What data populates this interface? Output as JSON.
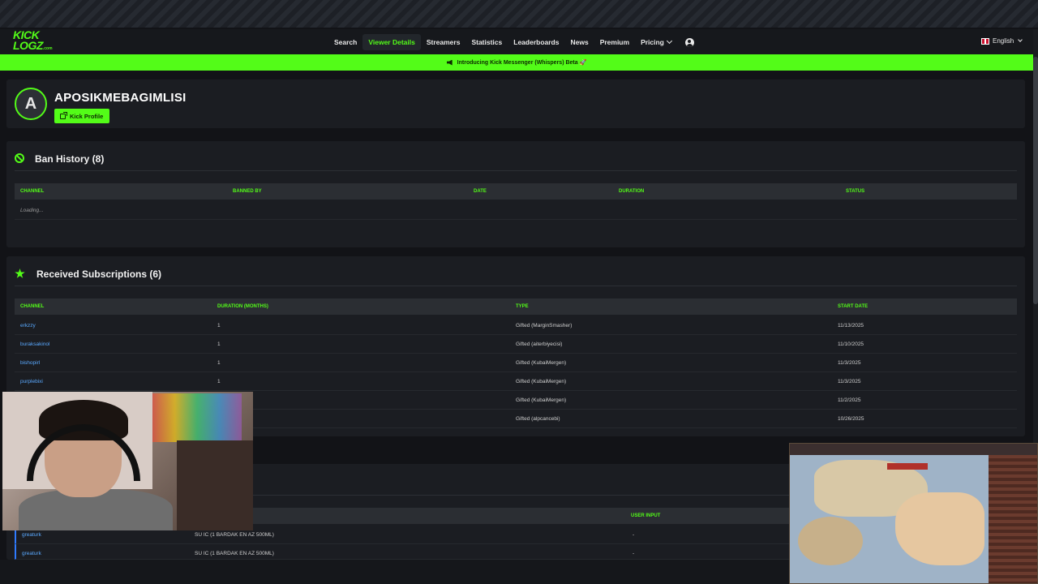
{
  "nav": {
    "logo_line1": "KICK",
    "logo_line2": "LOGZ",
    "logo_domain": ".com",
    "links": [
      "Search",
      "Viewer Details",
      "Streamers",
      "Statistics",
      "Leaderboards",
      "News",
      "Premium",
      "Pricing"
    ],
    "active_link": "Viewer Details",
    "language": "English"
  },
  "banner": {
    "text": "Introducing Kick Messenger (Whispers) Beta 🚀"
  },
  "profile": {
    "avatar_letter": "A",
    "username": "APOSIKMEBAGIMLISI",
    "kick_profile_label": "Kick Profile"
  },
  "ban_history": {
    "title": "Ban History (8)",
    "columns": [
      "CHANNEL",
      "BANNED BY",
      "DATE",
      "DURATION",
      "STATUS"
    ],
    "loading_text": "Loading..."
  },
  "subscriptions": {
    "title": "Received Subscriptions (6)",
    "columns": [
      "CHANNEL",
      "DURATION (MONTHS)",
      "TYPE",
      "START DATE"
    ],
    "rows": [
      {
        "channel": "erkzzy",
        "duration": "1",
        "type": "Gifted (MarginSmasher)",
        "start": "11/13/2025"
      },
      {
        "channel": "buraksakinol",
        "duration": "1",
        "type": "Gifted (aiterbiyecisi)",
        "start": "11/10/2025"
      },
      {
        "channel": "bishopirl",
        "duration": "1",
        "type": "Gifted (KubaiMergen)",
        "start": "11/3/2025"
      },
      {
        "channel": "purplebixi",
        "duration": "1",
        "type": "Gifted (KubaiMergen)",
        "start": "11/3/2025"
      },
      {
        "channel": "",
        "duration": "",
        "type": "Gifted (KubaiMergen)",
        "start": "11/2/2025"
      },
      {
        "channel": "",
        "duration": "",
        "type": "Gifted (alpcancebi)",
        "start": "10/26/2025"
      }
    ]
  },
  "third_section": {
    "columns": [
      "USER INPUT"
    ],
    "rows": [
      {
        "user": "greaturk",
        "item": "SU IC (1 BARDAK EN AZ 500ML)",
        "input": "-"
      },
      {
        "user": "greaturk",
        "item": "SU IC (1 BARDAK EN AZ 500ML)",
        "input": "-"
      }
    ]
  }
}
